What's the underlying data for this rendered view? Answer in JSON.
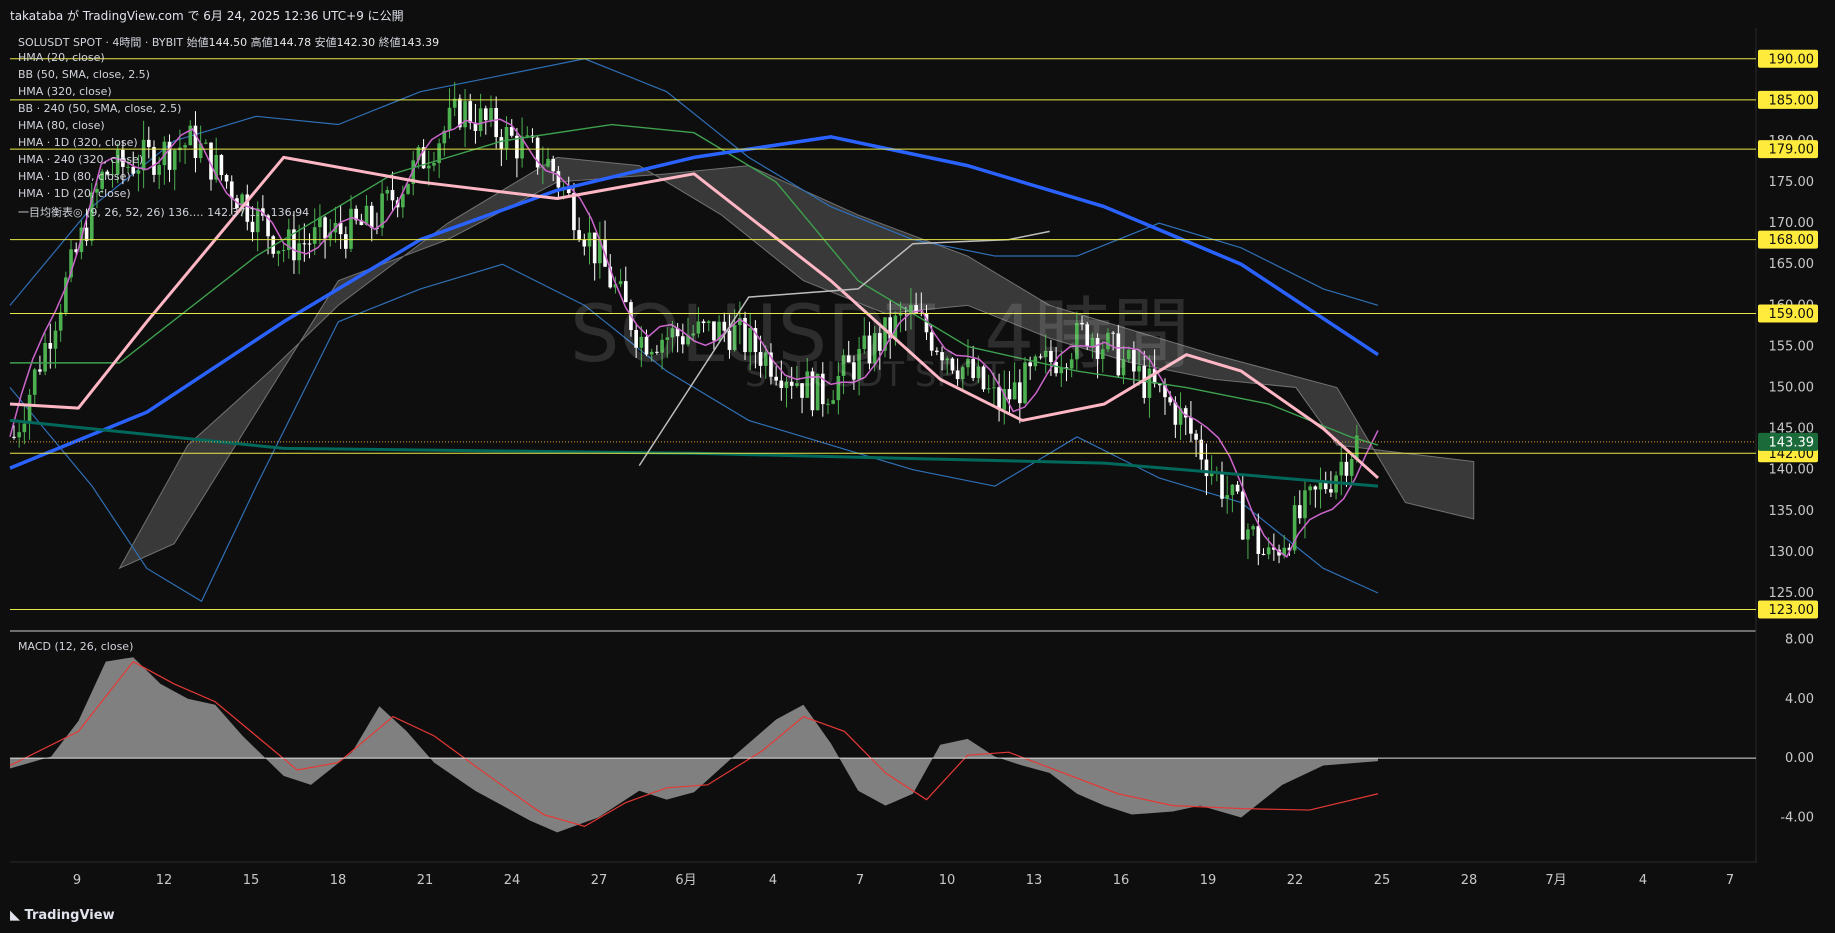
{
  "header": {
    "publish_text": "takataba が TradingView.com で 6月 24, 2025 12:36 UTC+9 に公開"
  },
  "legend": {
    "symbol_line": "SOLUSDT SPOT · 4時間 · BYBIT",
    "ohlc": {
      "open_label": "始値",
      "open": "144.50",
      "high_label": "高値",
      "high": "144.78",
      "low_label": "安値",
      "low": "142.30",
      "close_label": "終値",
      "close": "143.39"
    },
    "indicators": [
      "HMA (20, close)",
      "BB (50, SMA, close, 2.5)",
      "HMA (320, close)",
      "BB · 240 (50, SMA, close, 2.5)",
      "HMA (80, close)",
      "HMA · 1D (320, close)",
      "HMA · 240 (320, close)",
      "HMA · 1D (80, close)",
      "HMA · 1D (20, close)",
      "一目均衡表◎ (9, 26, 52, 26)  136.…  142.37  1…  136.94"
    ]
  },
  "watermark": {
    "main": "SOLUSDT, 4時間",
    "sub": "SOLUSDT SPOT"
  },
  "macd_label": "MACD (12, 26, close)",
  "footer": {
    "logo": "TradingView",
    "logo_icon": "tradingview-logo-icon"
  },
  "colors": {
    "background": "#0e0e0e",
    "up_candle": "#4caf50",
    "down_candle": "#ffffff",
    "hline": "#e8e84a",
    "hma20": "#cc66cc",
    "hma80": "#ffb7c5",
    "hma320": "#2962ff",
    "bb": "#2f6fb5",
    "hma1d": "#3ea04e",
    "hma320_240": "#00695c",
    "cloud": "#6f6f6f",
    "macd_hist": "#9e9e9e",
    "macd_signal": "#e53935"
  },
  "chart_data": [
    {
      "type": "candlestick",
      "title": "SOLUSDT SPOT · 4時間 · BYBIT",
      "y_axis_ticks": [
        "190.00",
        "185.00",
        "180.00",
        "175.00",
        "170.00",
        "165.00",
        "160.00",
        "155.00",
        "150.00",
        "145.00",
        "140.00",
        "135.00",
        "130.00",
        "125.00"
      ],
      "ylim": [
        120.5,
        193.5
      ],
      "x_axis_ticks": [
        "9",
        "12",
        "15",
        "18",
        "21",
        "24",
        "27",
        "6月",
        "4",
        "7",
        "10",
        "13",
        "16",
        "19",
        "22",
        "25",
        "28",
        "7月",
        "4",
        "7"
      ],
      "horizontal_levels": [
        190.0,
        185.0,
        179.0,
        168.0,
        159.0,
        142.0,
        123.0
      ],
      "horizontal_level_labels": [
        "190.00",
        "185.00",
        "179.00",
        "168.00",
        "159.00",
        "142.00",
        "123.00"
      ],
      "last_price": 143.39,
      "last_price_label": "143.39",
      "price_path": [
        {
          "x": "9",
          "y": 144.0
        },
        {
          "x": "12",
          "y": 176.0
        },
        {
          "x": "15",
          "y": 180.0
        },
        {
          "x": "18",
          "y": 167.0
        },
        {
          "x": "21",
          "y": 170.0
        },
        {
          "x": "24",
          "y": 184.0
        },
        {
          "x": "27",
          "y": 177.0
        },
        {
          "x": "6月",
          "y": 156.0
        },
        {
          "x": "4",
          "y": 157.0
        },
        {
          "x": "7",
          "y": 149.0
        },
        {
          "x": "10",
          "y": 159.0
        },
        {
          "x": "13",
          "y": 148.0
        },
        {
          "x": "16",
          "y": 157.0
        },
        {
          "x": "19",
          "y": 147.0
        },
        {
          "x": "22",
          "y": 129.0
        },
        {
          "x": "25",
          "y": 143.39
        }
      ],
      "series": [
        {
          "name": "HMA (320, close)",
          "color": "#2962ff",
          "points": [
            [
              0,
              140.2
            ],
            [
              0.1,
              147
            ],
            [
              0.2,
              158
            ],
            [
              0.3,
              168
            ],
            [
              0.4,
              174
            ],
            [
              0.5,
              178
            ],
            [
              0.6,
              180.5
            ],
            [
              0.7,
              177
            ],
            [
              0.8,
              172
            ],
            [
              0.9,
              165
            ],
            [
              1.0,
              154
            ]
          ]
        },
        {
          "name": "HMA (80, close)",
          "color": "#ffb7c5",
          "points": [
            [
              0,
              148
            ],
            [
              0.05,
              147.5
            ],
            [
              0.1,
              158
            ],
            [
              0.2,
              178
            ],
            [
              0.3,
              175
            ],
            [
              0.4,
              173
            ],
            [
              0.5,
              176
            ],
            [
              0.6,
              163
            ],
            [
              0.68,
              151
            ],
            [
              0.74,
              146
            ],
            [
              0.8,
              148
            ],
            [
              0.86,
              154
            ],
            [
              0.9,
              152
            ],
            [
              0.96,
              145
            ],
            [
              1.0,
              139
            ]
          ]
        },
        {
          "name": "HMA · 240 (320, close)",
          "color": "#00695c",
          "points": [
            [
              0,
              146
            ],
            [
              0.2,
              142.6
            ],
            [
              0.5,
              142.0
            ],
            [
              0.8,
              140.8
            ],
            [
              1.0,
              138.0
            ]
          ]
        }
      ]
    },
    {
      "type": "area",
      "title": "MACD (12, 26, close)",
      "y_axis_ticks": [
        "8.00",
        "4.00",
        "0.00",
        "-4.00"
      ],
      "ylim": [
        -7,
        8.5
      ],
      "histogram": [
        [
          0,
          -0.7
        ],
        [
          0.03,
          0.1
        ],
        [
          0.05,
          2.5
        ],
        [
          0.07,
          6.5
        ],
        [
          0.09,
          6.8
        ],
        [
          0.11,
          5.0
        ],
        [
          0.13,
          4.0
        ],
        [
          0.15,
          3.6
        ],
        [
          0.17,
          1.5
        ],
        [
          0.2,
          -1.2
        ],
        [
          0.22,
          -1.8
        ],
        [
          0.25,
          0.4
        ],
        [
          0.27,
          3.5
        ],
        [
          0.29,
          1.8
        ],
        [
          0.31,
          -0.3
        ],
        [
          0.34,
          -2.2
        ],
        [
          0.38,
          -4.2
        ],
        [
          0.4,
          -5.0
        ],
        [
          0.43,
          -4.0
        ],
        [
          0.46,
          -2.2
        ],
        [
          0.48,
          -2.8
        ],
        [
          0.5,
          -2.3
        ],
        [
          0.53,
          0.2
        ],
        [
          0.56,
          2.6
        ],
        [
          0.58,
          3.6
        ],
        [
          0.6,
          1.0
        ],
        [
          0.62,
          -2.2
        ],
        [
          0.64,
          -3.2
        ],
        [
          0.66,
          -2.4
        ],
        [
          0.68,
          0.9
        ],
        [
          0.7,
          1.3
        ],
        [
          0.72,
          0.1
        ],
        [
          0.74,
          -0.5
        ],
        [
          0.76,
          -1.0
        ],
        [
          0.78,
          -2.4
        ],
        [
          0.8,
          -3.2
        ],
        [
          0.82,
          -3.8
        ],
        [
          0.85,
          -3.6
        ],
        [
          0.87,
          -3.2
        ],
        [
          0.9,
          -4.0
        ],
        [
          0.93,
          -1.8
        ],
        [
          0.96,
          -0.5
        ],
        [
          1.0,
          -0.2
        ]
      ],
      "signal": [
        [
          0,
          -0.5
        ],
        [
          0.05,
          1.8
        ],
        [
          0.09,
          6.5
        ],
        [
          0.12,
          5.0
        ],
        [
          0.15,
          3.8
        ],
        [
          0.18,
          1.5
        ],
        [
          0.21,
          -0.8
        ],
        [
          0.24,
          -0.3
        ],
        [
          0.28,
          2.8
        ],
        [
          0.31,
          1.5
        ],
        [
          0.35,
          -1.2
        ],
        [
          0.39,
          -3.8
        ],
        [
          0.42,
          -4.6
        ],
        [
          0.45,
          -3.0
        ],
        [
          0.48,
          -2.0
        ],
        [
          0.51,
          -1.8
        ],
        [
          0.55,
          0.5
        ],
        [
          0.58,
          2.8
        ],
        [
          0.61,
          1.8
        ],
        [
          0.64,
          -1.0
        ],
        [
          0.67,
          -2.8
        ],
        [
          0.7,
          0.2
        ],
        [
          0.73,
          0.4
        ],
        [
          0.77,
          -1.0
        ],
        [
          0.81,
          -2.4
        ],
        [
          0.85,
          -3.2
        ],
        [
          0.9,
          -3.4
        ],
        [
          0.95,
          -3.5
        ],
        [
          1.0,
          -2.4
        ]
      ]
    }
  ]
}
